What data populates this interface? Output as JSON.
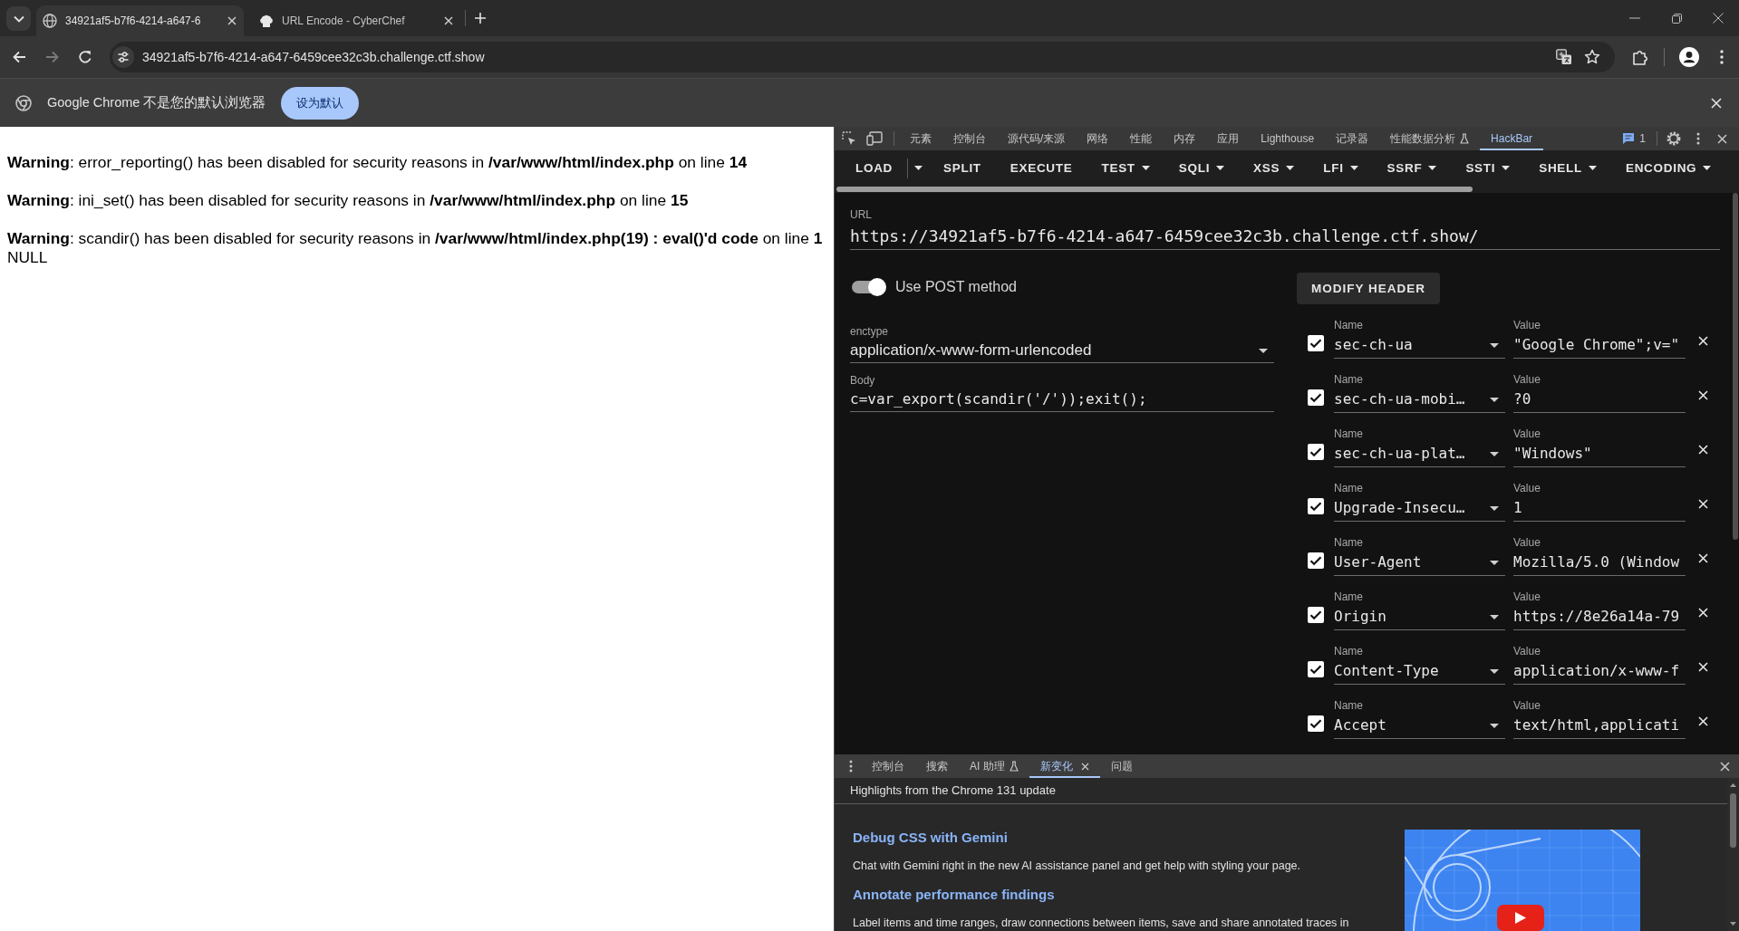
{
  "browser": {
    "tabs": [
      {
        "title": "34921af5-b7f6-4214-a647-6",
        "selected": true
      },
      {
        "title": "URL Encode - CyberChef",
        "selected": false
      }
    ],
    "address": "34921af5-b7f6-4214-a647-6459cee32c3b.challenge.ctf.show",
    "infobar": {
      "message": "Google Chrome 不是您的默认浏览器",
      "button": "设为默认"
    }
  },
  "page": {
    "warnings": [
      "**Warning**: error_reporting() has been disabled for security reasons in **/var/www/html/index.php** on line **14**",
      "**Warning**: ini_set() has been disabled for security reasons in **/var/www/html/index.php** on line **15**",
      "**Warning**: scandir() has been disabled for security reasons in **/var/www/html/index.php(19) : eval()'d code** on line **1**"
    ],
    "output": "NULL"
  },
  "devtools": {
    "tabs": [
      {
        "label": "元素",
        "selected": false,
        "experimental": false
      },
      {
        "label": "控制台",
        "selected": false,
        "experimental": false
      },
      {
        "label": "源代码/来源",
        "selected": false,
        "experimental": false
      },
      {
        "label": "网络",
        "selected": false,
        "experimental": false
      },
      {
        "label": "性能",
        "selected": false,
        "experimental": false
      },
      {
        "label": "内存",
        "selected": false,
        "experimental": false
      },
      {
        "label": "应用",
        "selected": false,
        "experimental": false
      },
      {
        "label": "Lighthouse",
        "selected": false,
        "experimental": false
      },
      {
        "label": "记录器",
        "selected": false,
        "experimental": false
      },
      {
        "label": "性能数据分析",
        "selected": false,
        "experimental": true
      },
      {
        "label": "HackBar",
        "selected": true,
        "experimental": false
      }
    ],
    "issues_count": "1"
  },
  "hackbar": {
    "toolbar": [
      {
        "label": "LOAD",
        "kind": "split"
      },
      {
        "label": "SPLIT",
        "kind": "plain"
      },
      {
        "label": "EXECUTE",
        "kind": "plain"
      },
      {
        "label": "TEST",
        "kind": "menu"
      },
      {
        "label": "SQLI",
        "kind": "menu"
      },
      {
        "label": "XSS",
        "kind": "menu"
      },
      {
        "label": "LFI",
        "kind": "menu"
      },
      {
        "label": "SSRF",
        "kind": "menu"
      },
      {
        "label": "SSTI",
        "kind": "menu"
      },
      {
        "label": "SHELL",
        "kind": "menu"
      },
      {
        "label": "ENCODING",
        "kind": "menu"
      }
    ],
    "url": {
      "label": "URL",
      "value": "https://34921af5-b7f6-4214-a647-6459cee32c3b.challenge.ctf.show/"
    },
    "post_method": {
      "label": "Use POST method",
      "on": true
    },
    "enctype": {
      "label": "enctype",
      "value": "application/x-www-form-urlencoded"
    },
    "body": {
      "label": "Body",
      "value": "c=var_export(scandir('/'));exit();"
    },
    "modify_header": "MODIFY HEADER",
    "headers": [
      {
        "checked": true,
        "name_label": "Name",
        "name": "sec-ch-ua",
        "value_label": "Value",
        "value": "\"Google Chrome\";v=\""
      },
      {
        "checked": true,
        "name_label": "Name",
        "name": "sec-ch-ua-mobi…",
        "value_label": "Value",
        "value": "?0"
      },
      {
        "checked": true,
        "name_label": "Name",
        "name": "sec-ch-ua-plat…",
        "value_label": "Value",
        "value": "\"Windows\""
      },
      {
        "checked": true,
        "name_label": "Name",
        "name": "Upgrade-Insecu…",
        "value_label": "Value",
        "value": "1"
      },
      {
        "checked": true,
        "name_label": "Name",
        "name": "User-Agent",
        "value_label": "Value",
        "value": "Mozilla/5.0 (Window"
      },
      {
        "checked": true,
        "name_label": "Name",
        "name": "Origin",
        "value_label": "Value",
        "value": "https://8e26a14a-79"
      },
      {
        "checked": true,
        "name_label": "Name",
        "name": "Content-Type",
        "value_label": "Value",
        "value": "application/x-www-f"
      },
      {
        "checked": true,
        "name_label": "Name",
        "name": "Accept",
        "value_label": "Value",
        "value": "text/html,applicati"
      }
    ]
  },
  "drawer": {
    "tabs": [
      {
        "label": "控制台",
        "selected": false,
        "experimental": false,
        "closable": false
      },
      {
        "label": "搜索",
        "selected": false,
        "experimental": false,
        "closable": false
      },
      {
        "label": "AI 助理",
        "selected": false,
        "experimental": true,
        "closable": false
      },
      {
        "label": "新变化",
        "selected": true,
        "experimental": false,
        "closable": true
      },
      {
        "label": "问题",
        "selected": false,
        "experimental": false,
        "closable": false
      }
    ],
    "heading": "Highlights from the Chrome 131 update",
    "features": [
      {
        "title": "Debug CSS with Gemini",
        "description": "Chat with Gemini right in the new AI assistance panel and get help with styling your page."
      },
      {
        "title": "Annotate performance findings",
        "description": "Label items and time ranges, draw connections between items, save and share annotated traces in"
      }
    ]
  }
}
